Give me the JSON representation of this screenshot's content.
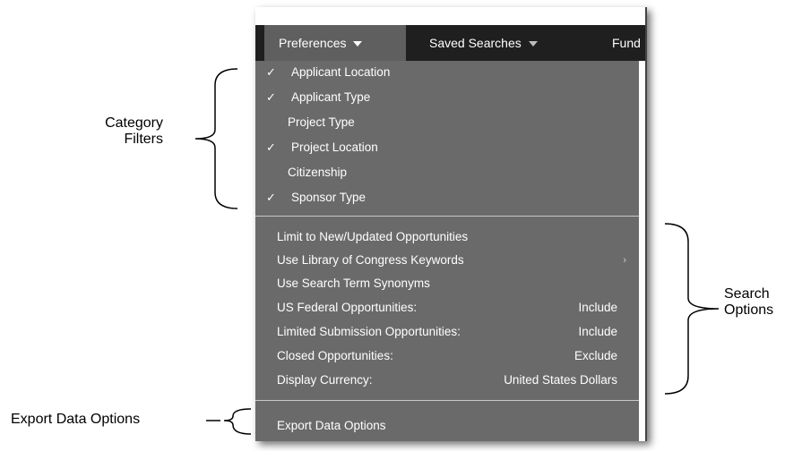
{
  "nav": {
    "items": [
      {
        "label": "Preferences",
        "active": true
      },
      {
        "label": "Saved Searches",
        "active": false
      },
      {
        "label": "Fund",
        "active": false
      }
    ]
  },
  "category_filters": [
    {
      "label": "Applicant Location",
      "checked": true
    },
    {
      "label": "Applicant Type",
      "checked": true
    },
    {
      "label": "Project Type",
      "checked": false
    },
    {
      "label": "Project Location",
      "checked": true
    },
    {
      "label": "Citizenship",
      "checked": false
    },
    {
      "label": "Sponsor Type",
      "checked": true
    }
  ],
  "check_mark": "✓",
  "search_options": [
    {
      "label": "Limit to New/Updated Opportunities",
      "value": ""
    },
    {
      "label": "Use Library of Congress Keywords",
      "value": "",
      "submenu": true
    },
    {
      "label": "Use Search Term Synonyms",
      "value": ""
    },
    {
      "label": "US Federal Opportunities:",
      "value": "Include"
    },
    {
      "label": "Limited Submission Opportunities:",
      "value": "Include"
    },
    {
      "label": "Closed Opportunities:",
      "value": "Exclude"
    },
    {
      "label": "Display Currency:",
      "value": "United States Dollars"
    }
  ],
  "export": {
    "label": "Export Data Options"
  },
  "annotations": {
    "category_filters_line1": "Category",
    "category_filters_line2": "Filters",
    "search_options_line1": "Search",
    "search_options_line2": "Options",
    "export_data_options": "Export Data Options"
  },
  "colors": {
    "navbar": "#1f1f1f",
    "nav_active": "#5f5f5f",
    "menu_bg": "#6a6a6a",
    "text": "#ffffff"
  }
}
